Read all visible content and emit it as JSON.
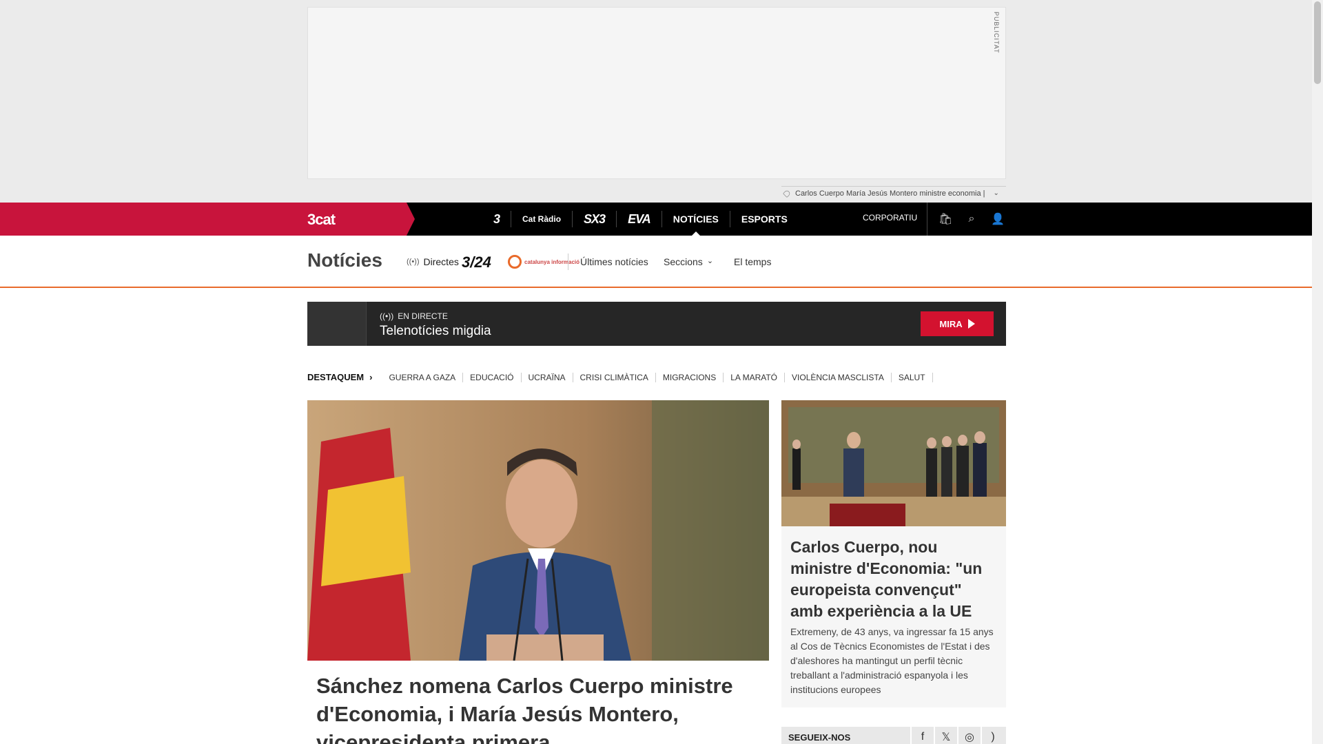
{
  "ad": {
    "label": "PUBLICITAT",
    "tags": "Carlos Cuerpo María Jesús Montero ministre economia |"
  },
  "topnav": {
    "brand": "3cat",
    "channels": [
      {
        "label": "3",
        "icon": "tv3-logo"
      },
      {
        "label": "Cat Ràdio",
        "icon": "catradio-logo"
      },
      {
        "label": "SX3",
        "icon": "sx3-logo"
      },
      {
        "label": "EVA",
        "icon": "eva-logo"
      },
      {
        "label": "NOTÍCIES",
        "active": true
      },
      {
        "label": "ESPORTS"
      }
    ],
    "corporate": "CORPORATIU",
    "icons": [
      "shopping-bag-icon",
      "search-icon",
      "user-icon"
    ]
  },
  "section_nav": {
    "title": "Notícies",
    "live_label": "Directes",
    "logo_324": "3/24",
    "logo_ci": "catalunya informació",
    "links": [
      "Últimes notícies",
      "Seccions",
      "El temps"
    ]
  },
  "live_banner": {
    "label": "EN DIRECTE",
    "title": "Telenotícies migdia",
    "button": "MIRA"
  },
  "highlights": {
    "title": "DESTAQUEM",
    "items": [
      "GUERRA A GAZA",
      "EDUCACIÓ",
      "UCRAÏNA",
      "CRISI CLIMÀTICA",
      "MIGRACIONS",
      "LA MARATÓ",
      "VIOLÈNCIA MASCLISTA",
      "SALUT"
    ]
  },
  "main_story": {
    "title": "Sánchez nomena Carlos Cuerpo ministre d'Economia, i María Jesús Montero, vicepresidenta primera"
  },
  "side_story": {
    "title": "Carlos Cuerpo, nou ministre d'Economia: \"un europeista convençut\" amb experiència a la UE",
    "summary": "Extremeny, de 43 anys, va ingressar fa 15 anys al Cos de Tècnics Economistes de l'Estat i des d'aleshores ha mantingut un perfil tècnic treballant a l'administració espanyola i les institucions europees"
  },
  "follow": {
    "label": "SEGUEIX-NOS",
    "networks": [
      "facebook-icon",
      "x-icon",
      "instagram-icon",
      "rss-icon"
    ]
  },
  "colors": {
    "brand": "#c8143c",
    "accent": "#e96a2a",
    "live_button": "#d3122f"
  }
}
